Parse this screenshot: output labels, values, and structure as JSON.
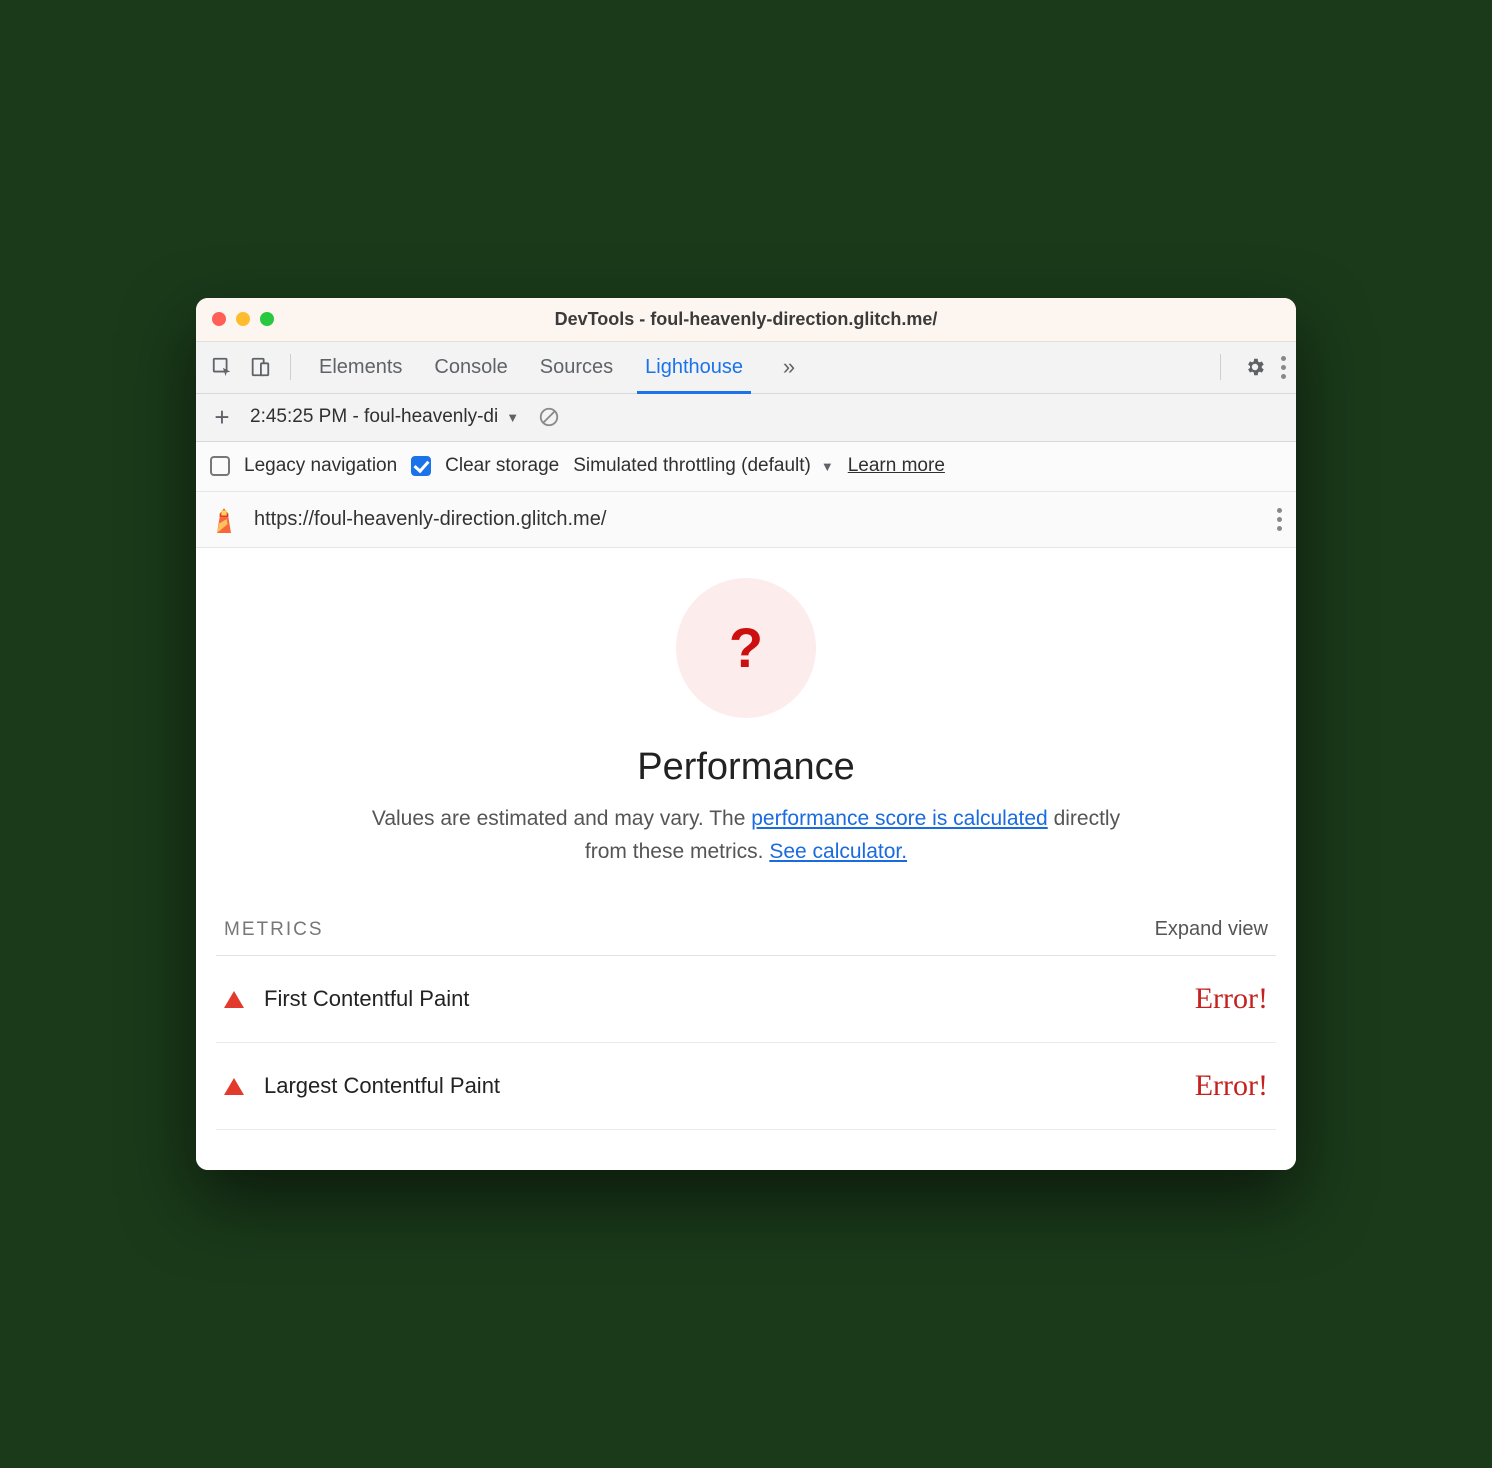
{
  "window": {
    "title": "DevTools - foul-heavenly-direction.glitch.me/"
  },
  "tabs": {
    "items": [
      "Elements",
      "Console",
      "Sources",
      "Lighthouse"
    ],
    "active_index": 3
  },
  "run_selector": {
    "label": "2:45:25 PM - foul-heavenly-di"
  },
  "options": {
    "legacy_nav_label": "Legacy navigation",
    "legacy_nav_checked": false,
    "clear_storage_label": "Clear storage",
    "clear_storage_checked": true,
    "throttling_label": "Simulated throttling (default)",
    "learn_more": "Learn more"
  },
  "report": {
    "url": "https://foul-heavenly-direction.glitch.me/",
    "gauge_symbol": "?",
    "category_title": "Performance",
    "desc_prefix": "Values are estimated and may vary. The ",
    "desc_link1": "performance score is calculated",
    "desc_mid": " directly from these metrics. ",
    "desc_link2": "See calculator.",
    "metrics_heading": "METRICS",
    "expand_view": "Expand view",
    "metrics": [
      {
        "name": "First Contentful Paint",
        "value": "Error!"
      },
      {
        "name": "Largest Contentful Paint",
        "value": "Error!"
      }
    ]
  }
}
